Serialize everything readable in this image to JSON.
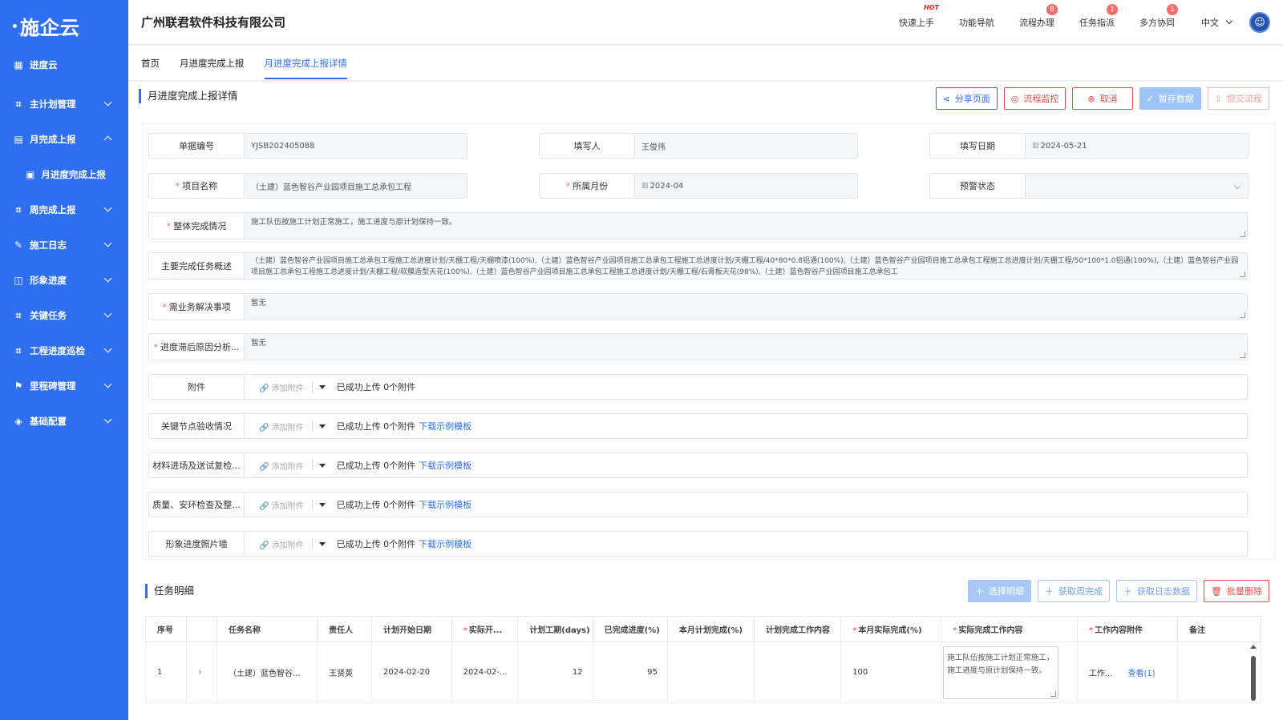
{
  "app": {
    "logo": "施企云",
    "company": "广州联君软件科技有限公司"
  },
  "colors": {
    "brand": "#2e6ff0",
    "danger": "#e84a4a",
    "badge": "#f56c6c"
  },
  "sidebar": {
    "items": [
      {
        "label": "进度云",
        "icon": "grid-icon"
      },
      {
        "label": "主计划管理",
        "icon": "org-icon"
      },
      {
        "label": "月完成上报",
        "icon": "clipboard-icon"
      },
      {
        "label": "月进度完成上报",
        "icon": "clipboard-check-icon"
      },
      {
        "label": "周完成上报",
        "icon": "org-icon"
      },
      {
        "label": "施工日志",
        "icon": "log-icon"
      },
      {
        "label": "形象进度",
        "icon": "coins-icon"
      },
      {
        "label": "关键任务",
        "icon": "org-icon"
      },
      {
        "label": "工程进度巡检",
        "icon": "org-icon"
      },
      {
        "label": "里程碑管理",
        "icon": "milestone-icon"
      },
      {
        "label": "基础配置",
        "icon": "layers-icon"
      }
    ]
  },
  "header": {
    "links": [
      {
        "label": "快速上手",
        "badge": "HOT"
      },
      {
        "label": "功能导航",
        "badge": ""
      },
      {
        "label": "流程办理",
        "badge": "8"
      },
      {
        "label": "任务指派",
        "badge": "1"
      },
      {
        "label": "多方协同",
        "badge": "1"
      }
    ],
    "language": "中文"
  },
  "tabs": [
    "首页",
    "月进度完成上报",
    "月进度完成上报详情"
  ],
  "page": {
    "title": "月进度完成上报详情",
    "buttons": [
      "分享页面",
      "流程监控",
      "取消",
      "暂存数据",
      "提交流程"
    ]
  },
  "form": {
    "doc_no": {
      "label": "单据编号",
      "value": "YJSB202405088"
    },
    "filler": {
      "label": "填写人",
      "value": "王俊伟"
    },
    "fill_date": {
      "label": "填写日期",
      "value": "2024-05-21"
    },
    "project": {
      "label": "项目名称",
      "value": "（土建）蓝色智谷产业园项目施工总承包工程"
    },
    "month": {
      "label": "所属月份",
      "value": "2024-04"
    },
    "warning": {
      "label": "预警状态",
      "value": ""
    },
    "overall": {
      "label": "整体完成情况",
      "value": "施工队伍按施工计划正常施工，施工进度与原计划保持一致。"
    },
    "summary": {
      "label": "主要完成任务概述",
      "value": "（土建）蓝色智谷产业园项目施工总承包工程施工总进度计划/天棚工程/天棚喷漆(100%),（土建）蓝色智谷产业园项目施工总承包工程施工总进度计划/天棚工程/40*80*0.8铝通(100%),（土建）蓝色智谷产业园项目施工总承包工程施工总进度计划/天棚工程/50*100*1.0铝通(100%),（土建）蓝色智谷产业园项目施工总承包工程施工总进度计划/天棚工程/软膜造型天花(100%),（土建）蓝色智谷产业园项目施工总承包工程施工总进度计划/天棚工程/石膏板天花(98%),（土建）蓝色智谷产业园项目施工总承包工"
    },
    "issues": {
      "label": "需业务解决事项",
      "value": "暂无"
    },
    "delay": {
      "label": "进度滞后原因分析...",
      "value": "暂无"
    },
    "attachments": [
      {
        "label": "附件",
        "add": "添加附件",
        "status": "已成功上传 0个附件",
        "template": ""
      },
      {
        "label": "关键节点验收情况",
        "add": "添加附件",
        "status": "已成功上传 0个附件",
        "template": "下载示例模板"
      },
      {
        "label": "材料进场及送试复检...",
        "add": "添加附件",
        "status": "已成功上传 0个附件",
        "template": "下载示例模板"
      },
      {
        "label": "质量、安环检查及整...",
        "add": "添加附件",
        "status": "已成功上传 0个附件",
        "template": "下载示例模板"
      },
      {
        "label": "形象进度照片墙",
        "add": "添加附件",
        "status": "已成功上传 0个附件",
        "template": "下载示例模板"
      }
    ]
  },
  "tasks": {
    "title": "任务明细",
    "buttons": [
      "选择明细",
      "获取周完成",
      "获取日志数据",
      "批量删除"
    ],
    "columns": [
      "序号",
      "",
      "任务名称",
      "责任人",
      "计划开始日期",
      "实际开...",
      "计划工期(days)",
      "已完成进度(%)",
      "本月计划完成(%)",
      "计划完成工作内容",
      "本月实际完成(%)",
      "实际完成工作内容",
      "工作内容附件",
      "备注"
    ],
    "rows": [
      {
        "no": "1",
        "expand": "›",
        "name": "（土建）蓝色智谷...",
        "owner": "王贤英",
        "plan_start": "2024-02-20",
        "actual_start": "2024-02-...",
        "duration": "12",
        "done": "95",
        "month_plan": "",
        "plan_content": "",
        "month_actual": "100",
        "actual_content": "施工队伍按施工计划正常施工，施工进度与原计划保持一致。",
        "attach": "工作...",
        "view": "查看(1)",
        "remark": ""
      }
    ]
  }
}
